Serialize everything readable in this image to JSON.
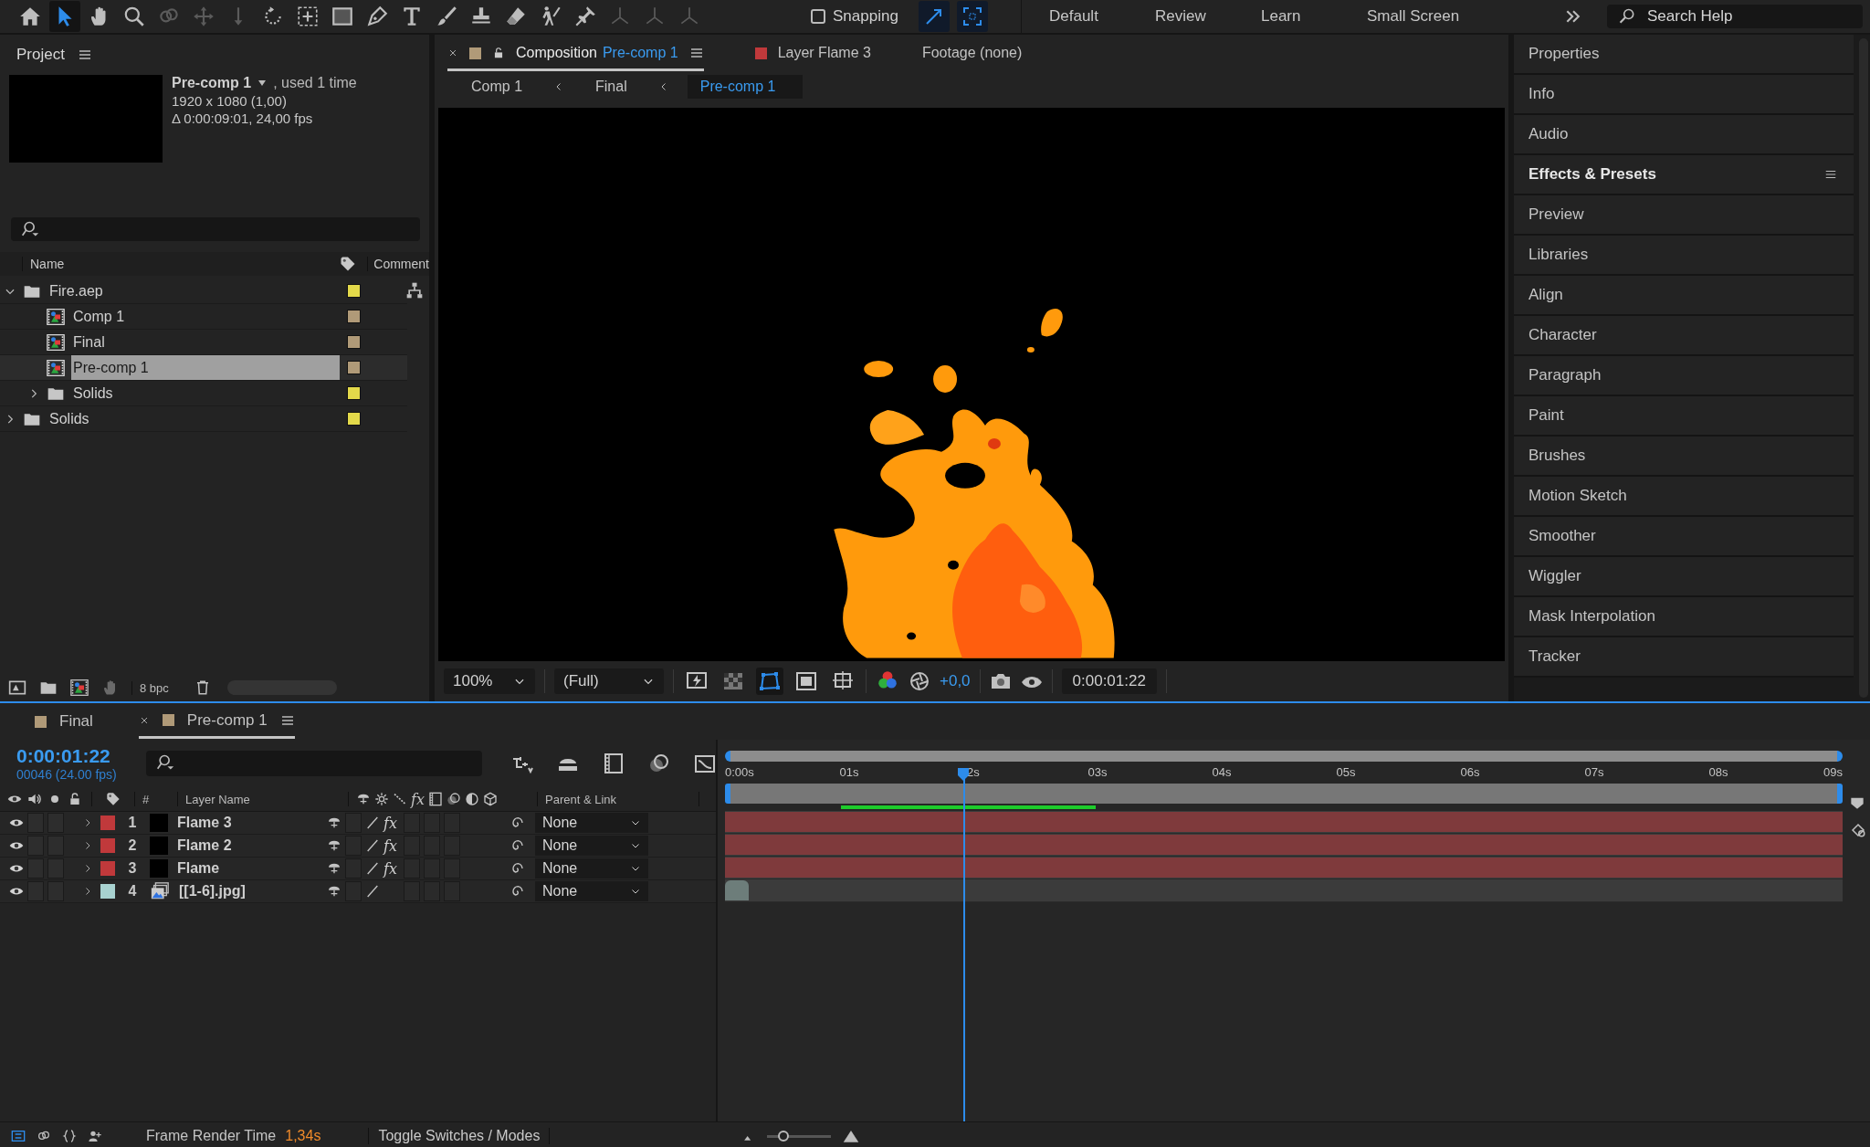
{
  "toolbar": {
    "tools": [
      {
        "kind": "home",
        "selected": false,
        "disabled": false
      },
      {
        "kind": "pointer",
        "selected": true,
        "disabled": false
      },
      {
        "kind": "hand",
        "selected": false,
        "disabled": false
      },
      {
        "kind": "magnifier",
        "selected": false,
        "disabled": false
      },
      {
        "kind": "orbit",
        "selected": false,
        "disabled": true
      },
      {
        "kind": "move",
        "selected": false,
        "disabled": true
      },
      {
        "kind": "dolly",
        "selected": false,
        "disabled": true
      },
      {
        "kind": "rotate",
        "selected": false,
        "disabled": false
      },
      {
        "kind": "anchor",
        "selected": false,
        "disabled": false
      },
      {
        "kind": "rectangle",
        "selected": false,
        "disabled": false
      },
      {
        "kind": "pen",
        "selected": false,
        "disabled": false
      },
      {
        "kind": "type",
        "selected": false,
        "disabled": false
      },
      {
        "kind": "brush",
        "selected": false,
        "disabled": false
      },
      {
        "kind": "stamp",
        "selected": false,
        "disabled": false
      },
      {
        "kind": "eraser",
        "selected": false,
        "disabled": false
      },
      {
        "kind": "puppet",
        "selected": false,
        "disabled": false
      },
      {
        "kind": "pin",
        "selected": false,
        "disabled": false
      },
      {
        "kind": "axis",
        "selected": false,
        "disabled": true
      },
      {
        "kind": "axis",
        "selected": false,
        "disabled": true
      },
      {
        "kind": "axis",
        "selected": false,
        "disabled": true
      }
    ],
    "snapping": {
      "label": "Snapping",
      "checked": false
    },
    "snap_options": [
      {
        "kind": "edge",
        "on": true
      },
      {
        "kind": "frame",
        "on": true
      }
    ],
    "workspaces": [
      {
        "label": "Default"
      },
      {
        "label": "Review"
      },
      {
        "label": "Learn"
      },
      {
        "label": "Small Screen"
      }
    ],
    "search_help": {
      "placeholder": "Search Help"
    }
  },
  "project": {
    "title": "Project",
    "selected_name": "Pre-comp 1",
    "usage": ", used 1 time",
    "dimensions": "1920 x 1080 (1,00)",
    "duration": "Δ 0:00:09:01, 24,00 fps",
    "columns": {
      "name": "Name",
      "comment": "Comment"
    },
    "items": [
      {
        "name": "Fire.aep",
        "kind": "folder",
        "color": "#e3d94a",
        "expanded": true,
        "selected": false,
        "children": [
          {
            "name": "Comp 1",
            "kind": "composition",
            "color": "#b09a78",
            "selected": false
          },
          {
            "name": "Final",
            "kind": "composition",
            "color": "#b09a78",
            "selected": false
          },
          {
            "name": "Pre-comp 1",
            "kind": "composition",
            "color": "#b09a78",
            "selected": true
          },
          {
            "name": "Solids",
            "kind": "folder",
            "color": "#e3d94a",
            "expanded": false,
            "selected": false
          }
        ]
      },
      {
        "name": "Solids",
        "kind": "folder",
        "color": "#e3d94a",
        "expanded": false,
        "selected": false
      }
    ],
    "bit_depth": "8 bpc"
  },
  "composition": {
    "tabs": [
      {
        "kind": "composition",
        "prefix": "Composition",
        "label": "Pre-comp 1",
        "color": "#b09a78",
        "selected": true
      },
      {
        "kind": "layer",
        "label": "Layer Flame 3",
        "color": "#c0393b",
        "selected": false
      },
      {
        "kind": "footage",
        "label": "Footage (none)",
        "selected": false
      }
    ],
    "breadcrumbs": [
      {
        "label": "Comp 1",
        "selected": false
      },
      {
        "label": "Final",
        "selected": false
      },
      {
        "label": "Pre-comp 1",
        "selected": true
      }
    ],
    "zoom": "100%",
    "resolution": "(Full)",
    "view_toggles": [
      {
        "kind": "fast-preview",
        "on": false
      },
      {
        "kind": "transparency",
        "on": false
      },
      {
        "kind": "mask",
        "on": true
      },
      {
        "kind": "region",
        "on": false
      },
      {
        "kind": "grid",
        "on": false
      }
    ],
    "exposure": "+0,0",
    "timecode": "0:00:01:22"
  },
  "panels": [
    {
      "label": "Properties",
      "active": false
    },
    {
      "label": "Info",
      "active": false
    },
    {
      "label": "Audio",
      "active": false
    },
    {
      "label": "Effects & Presets",
      "active": true
    },
    {
      "label": "Preview",
      "active": false
    },
    {
      "label": "Libraries",
      "active": false
    },
    {
      "label": "Align",
      "active": false
    },
    {
      "label": "Character",
      "active": false
    },
    {
      "label": "Paragraph",
      "active": false
    },
    {
      "label": "Paint",
      "active": false
    },
    {
      "label": "Brushes",
      "active": false
    },
    {
      "label": "Motion Sketch",
      "active": false
    },
    {
      "label": "Smoother",
      "active": false
    },
    {
      "label": "Wiggler",
      "active": false
    },
    {
      "label": "Mask Interpolation",
      "active": false
    },
    {
      "label": "Tracker",
      "active": false
    }
  ],
  "timeline": {
    "tabs": [
      {
        "label": "Final",
        "color": "#b09a78",
        "selected": false
      },
      {
        "label": "Pre-comp 1",
        "color": "#b09a78",
        "selected": true
      }
    ],
    "current_time": "0:00:01:22",
    "frame_info": "00046 (24.00 fps)",
    "columns": {
      "number": "#",
      "name": "Layer Name",
      "fx": "fx",
      "parent": "Parent & Link"
    },
    "layers": [
      {
        "number": "1",
        "name": "Flame 3",
        "color": "#c0393b",
        "kind": "solid",
        "effects": "fx",
        "effects_on": true,
        "visible": true,
        "parent": "None"
      },
      {
        "number": "2",
        "name": "Flame 2",
        "color": "#c0393b",
        "kind": "solid",
        "effects": "fx",
        "effects_on": true,
        "visible": true,
        "parent": "None"
      },
      {
        "number": "3",
        "name": "Flame",
        "color": "#c0393b",
        "kind": "solid",
        "effects": "fx",
        "effects_on": true,
        "visible": true,
        "parent": "None"
      },
      {
        "number": "4",
        "name": "[[1-6].jpg]",
        "color": "#a8d2d0",
        "kind": "footage",
        "visible": true,
        "parent": "None"
      }
    ],
    "ruler": [
      "0:00s",
      "01s",
      "2s",
      "03s",
      "04s",
      "05s",
      "06s",
      "07s",
      "08s",
      "09s"
    ],
    "playhead": {
      "level": 0.213
    },
    "zoom": {
      "level": 0.25
    }
  },
  "status_bar": {
    "render_label": "Frame Render Time",
    "render_time": "1,34s",
    "toggle": "Toggle Switches / Modes"
  }
}
